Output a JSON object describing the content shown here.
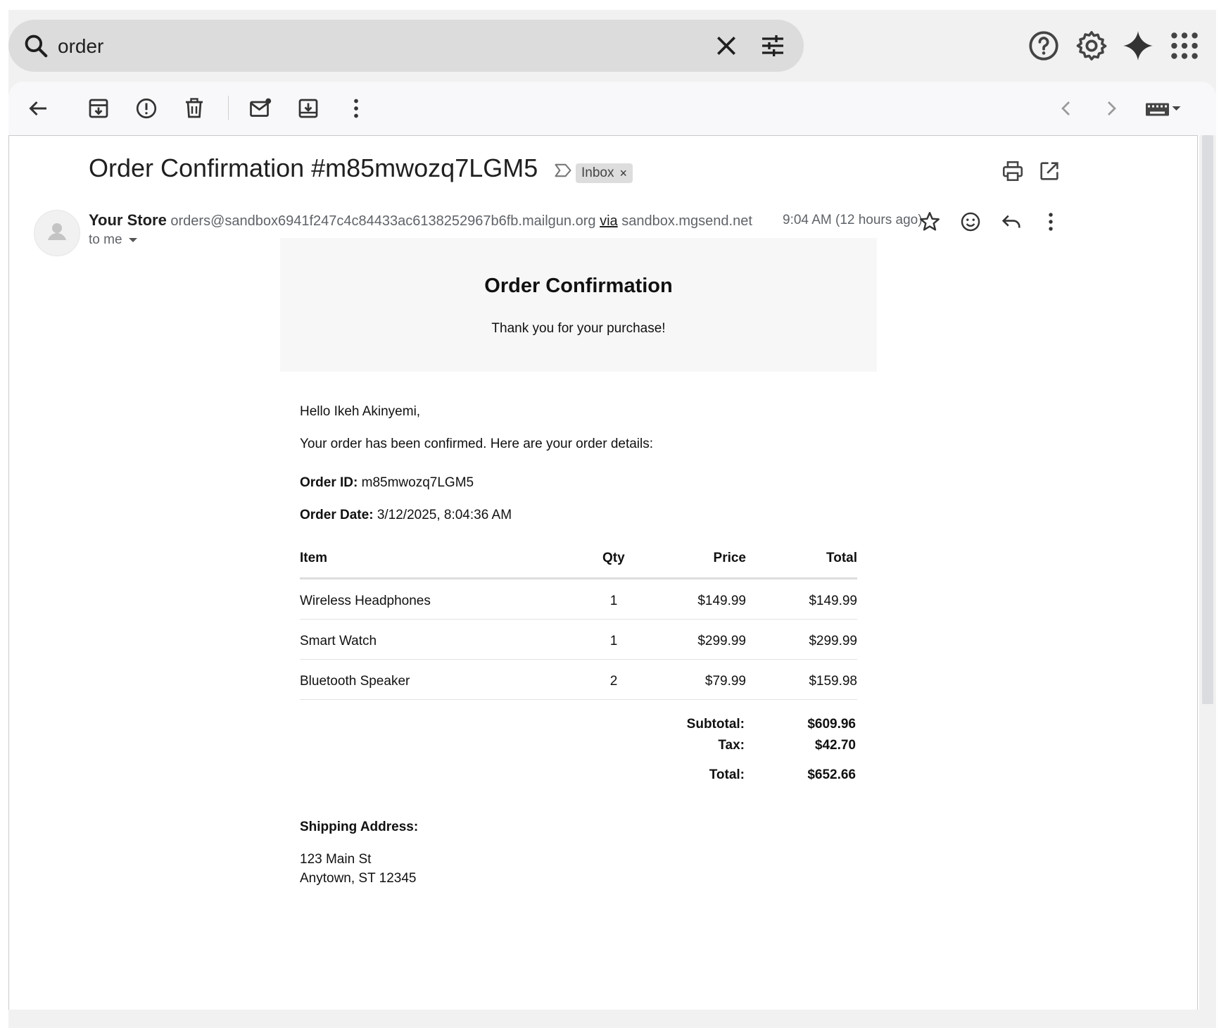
{
  "search": {
    "value": "order"
  },
  "email": {
    "subject": "Order Confirmation #m85mwozq7LGM5",
    "label_chip": "Inbox",
    "chip_remove": "×",
    "sender_name": "Your Store",
    "sender_email": "orders@sandbox6941f247c4c84433ac6138252967b6fb.mailgun.org",
    "via_word": "via",
    "via_domain": "sandbox.mgsend.net",
    "recipient": "to me",
    "timestamp": "9:04 AM (12 hours ago)"
  },
  "body": {
    "title": "Order Confirmation",
    "subtitle": "Thank you for your purchase!",
    "greeting": "Hello Ikeh Akinyemi,",
    "intro": "Your order has been confirmed. Here are your order details:",
    "order_id_label": "Order ID:",
    "order_id": "m85mwozq7LGM5",
    "order_date_label": "Order Date:",
    "order_date": "3/12/2025, 8:04:36 AM",
    "table": {
      "headers": {
        "item": "Item",
        "qty": "Qty",
        "price": "Price",
        "total": "Total"
      },
      "rows": [
        {
          "item": "Wireless Headphones",
          "qty": "1",
          "price": "$149.99",
          "total": "$149.99"
        },
        {
          "item": "Smart Watch",
          "qty": "1",
          "price": "$299.99",
          "total": "$299.99"
        },
        {
          "item": "Bluetooth Speaker",
          "qty": "2",
          "price": "$79.99",
          "total": "$159.98"
        }
      ]
    },
    "totals": {
      "subtotal_label": "Subtotal:",
      "subtotal": "$609.96",
      "tax_label": "Tax:",
      "tax": "$42.70",
      "total_label": "Total:",
      "total": "$652.66"
    },
    "shipping_label": "Shipping Address:",
    "address_line1": "123 Main St",
    "address_line2": "Anytown, ST 12345"
  }
}
